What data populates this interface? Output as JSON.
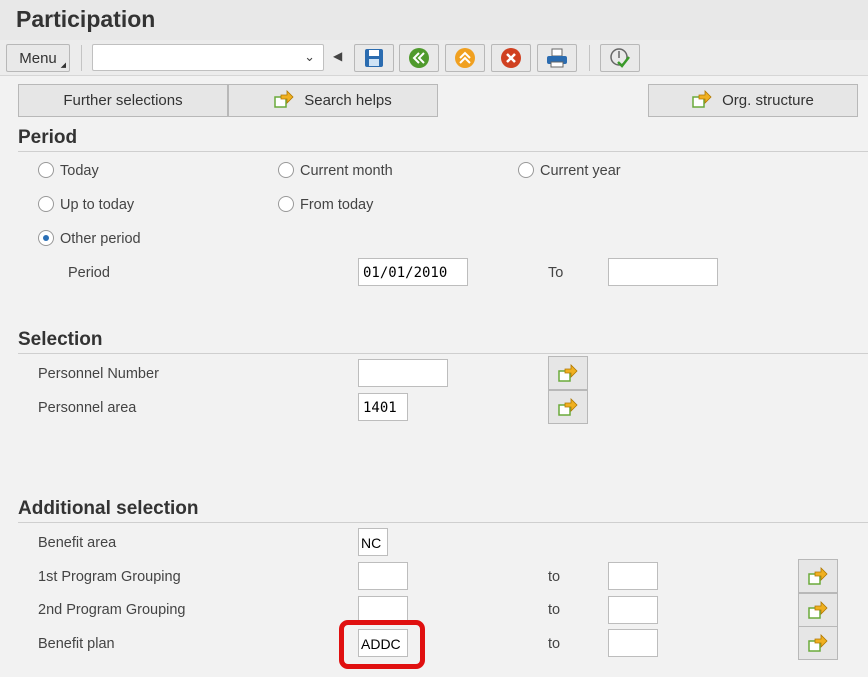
{
  "title": "Participation",
  "toolbar": {
    "menu": "Menu",
    "command_value": "",
    "icons": [
      "back-arrow-icon",
      "save-icon",
      "back-icon",
      "exit-icon",
      "cancel-icon",
      "print-icon",
      "execute-icon"
    ]
  },
  "buttons": {
    "further": "Further selections",
    "search": "Search helps",
    "org": "Org. structure"
  },
  "period": {
    "heading": "Period",
    "today": "Today",
    "current_month": "Current month",
    "current_year": "Current year",
    "up_to_today": "Up to today",
    "from_today": "From today",
    "other_period": "Other period",
    "selected": "Other period",
    "period_label": "Period",
    "from_value": "01/01/2010",
    "to_label": "To",
    "to_value": ""
  },
  "selection": {
    "heading": "Selection",
    "pernr_label": "Personnel Number",
    "pernr_value": "",
    "parea_label": "Personnel area",
    "parea_value": "1401"
  },
  "additional": {
    "heading": "Additional selection",
    "to": "to",
    "benefit_area": {
      "label": "Benefit area",
      "value": "NC"
    },
    "grp1": {
      "label": "1st Program Grouping",
      "value": "",
      "to": ""
    },
    "grp2": {
      "label": "2nd Program Grouping",
      "value": "",
      "to": ""
    },
    "plan": {
      "label": "Benefit plan",
      "value": "ADDC",
      "to": ""
    }
  },
  "colors": {
    "highlight": "#e01010"
  }
}
